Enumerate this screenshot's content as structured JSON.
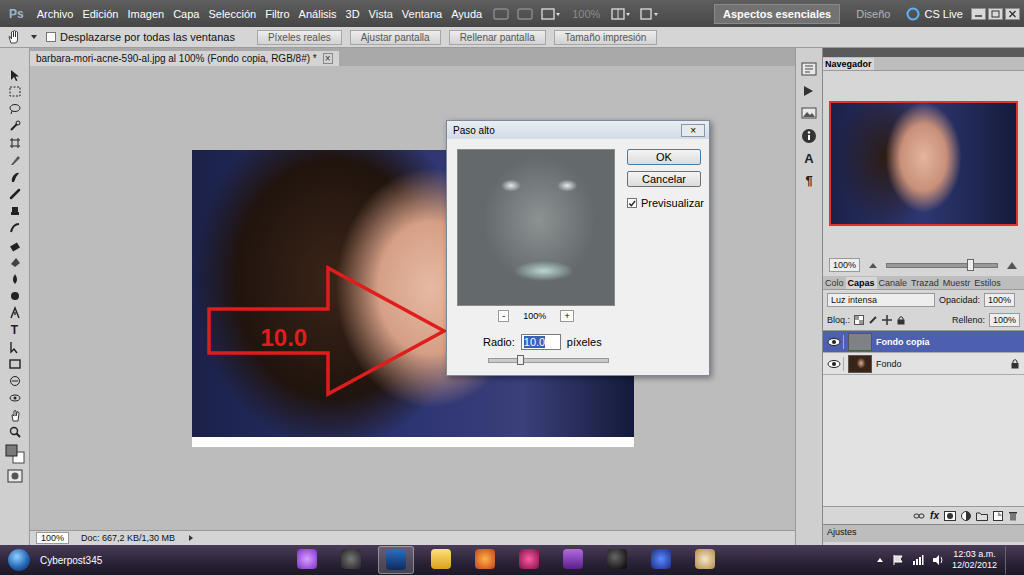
{
  "app": {
    "logo": "Ps"
  },
  "menu": [
    "Archivo",
    "Edición",
    "Imagen",
    "Capa",
    "Selección",
    "Filtro",
    "Análisis",
    "3D",
    "Vista",
    "Ventana",
    "Ayuda"
  ],
  "app_bar": {
    "zoom": "100%",
    "workspaces": [
      {
        "label": "Aspectos esenciales",
        "selected": true
      },
      {
        "label": "Diseño",
        "selected": false
      }
    ],
    "cs_live": "CS Live"
  },
  "options_bar": {
    "checkbox": {
      "label": "Desplazarse por todas las ventanas",
      "checked": false
    },
    "buttons": [
      "Píxeles reales",
      "Ajustar pantalla",
      "Rellenar pantalla",
      "Tamaño impresión"
    ]
  },
  "tools": {
    "text_tool": "T"
  },
  "document": {
    "tab": "barbara-mori-acne-590-al.jpg al 100% (Fondo copia, RGB/8#) *",
    "close": "×",
    "annotation": "10.0",
    "zoom": "100%",
    "doc_info": "Doc: 667,2 KB/1,30 MB"
  },
  "side_strip": [
    "A",
    "¶"
  ],
  "dialog": {
    "title": "Paso alto",
    "close": "×",
    "zoom_minus": "-",
    "zoom": "100%",
    "zoom_plus": "+",
    "buttons": [
      "OK",
      "Cancelar"
    ],
    "preview": {
      "label": "Previsualizar",
      "checked": true
    },
    "radius_label": "Radio:",
    "radius_value": "10.0",
    "unit": "píxeles",
    "slider_level": 0.27
  },
  "navigator": {
    "tab": "Navegador",
    "zoom": "100%",
    "slider_level": 0.76
  },
  "layers_panel": {
    "tabs": [
      {
        "label": "Colo",
        "selected": false
      },
      {
        "label": "Capas",
        "selected": true
      },
      {
        "label": "Canale",
        "selected": false
      },
      {
        "label": "Trazad",
        "selected": false
      },
      {
        "label": "Muestr",
        "selected": false
      },
      {
        "label": "Estilos",
        "selected": false
      }
    ],
    "blend_mode": "Luz intensa",
    "opacity_label": "Opacidad:",
    "opacity": "100%",
    "lock_label": "Bloq.:",
    "fill_label": "Relleno:",
    "fill": "100%",
    "layers": [
      {
        "name": "Fondo copia",
        "selected": true,
        "visible": true,
        "locked": false
      },
      {
        "name": "Fondo",
        "selected": false,
        "visible": true,
        "locked": true
      }
    ],
    "footer_fx": "fx"
  },
  "adjustments": {
    "tab": "Ajustes"
  },
  "taskbar": {
    "user": "Cyberpost345",
    "time": "12:03 a.m.",
    "date": "12/02/2012"
  }
}
